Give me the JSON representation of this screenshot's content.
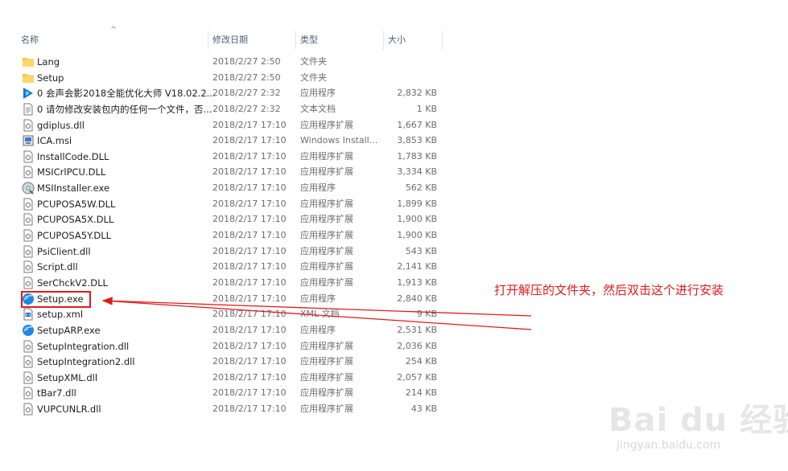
{
  "header": {
    "col_name": "名称",
    "col_date": "修改日期",
    "col_type": "类型",
    "col_size": "大小",
    "sort_arrow": "^"
  },
  "files": [
    {
      "name": "Lang",
      "date": "2018/2/27 2:50",
      "type": "文件夹",
      "size": "",
      "icon": "folder-icon"
    },
    {
      "name": "Setup",
      "date": "2018/2/27 2:50",
      "type": "文件夹",
      "size": "",
      "icon": "folder-icon"
    },
    {
      "name": "0 会声会影2018全能优化大师 V18.02.2...",
      "date": "2018/2/27 2:32",
      "type": "应用程序",
      "size": "2,832 KB",
      "icon": "app-blue-icon"
    },
    {
      "name": "0 请勿修改安装包内的任何一个文件，否...",
      "date": "2018/2/27 2:32",
      "type": "文本文档",
      "size": "1 KB",
      "icon": "text-file-icon"
    },
    {
      "name": "gdiplus.dll",
      "date": "2018/2/17 17:10",
      "type": "应用程序扩展",
      "size": "1,667 KB",
      "icon": "dll-icon"
    },
    {
      "name": "ICA.msi",
      "date": "2018/2/17 17:10",
      "type": "Windows Install...",
      "size": "3,853 KB",
      "icon": "msi-icon"
    },
    {
      "name": "InstallCode.DLL",
      "date": "2018/2/17 17:10",
      "type": "应用程序扩展",
      "size": "1,783 KB",
      "icon": "dll-icon"
    },
    {
      "name": "MSICrlPCU.DLL",
      "date": "2018/2/17 17:10",
      "type": "应用程序扩展",
      "size": "3,334 KB",
      "icon": "dll-icon"
    },
    {
      "name": "MSIInstaller.exe",
      "date": "2018/2/17 17:10",
      "type": "应用程序",
      "size": "562 KB",
      "icon": "cd-installer-icon"
    },
    {
      "name": "PCUPOSA5W.DLL",
      "date": "2018/2/17 17:10",
      "type": "应用程序扩展",
      "size": "1,899 KB",
      "icon": "dll-icon"
    },
    {
      "name": "PCUPOSA5X.DLL",
      "date": "2018/2/17 17:10",
      "type": "应用程序扩展",
      "size": "1,900 KB",
      "icon": "dll-icon"
    },
    {
      "name": "PCUPOSA5Y.DLL",
      "date": "2018/2/17 17:10",
      "type": "应用程序扩展",
      "size": "1,900 KB",
      "icon": "dll-icon"
    },
    {
      "name": "PsiClient.dll",
      "date": "2018/2/17 17:10",
      "type": "应用程序扩展",
      "size": "543 KB",
      "icon": "dll-icon"
    },
    {
      "name": "Script.dll",
      "date": "2018/2/17 17:10",
      "type": "应用程序扩展",
      "size": "2,141 KB",
      "icon": "dll-icon"
    },
    {
      "name": "SerChckV2.DLL",
      "date": "2018/2/17 17:10",
      "type": "应用程序扩展",
      "size": "1,913 KB",
      "icon": "dll-icon"
    },
    {
      "name": "Setup.exe",
      "date": "2018/2/17 17:10",
      "type": "应用程序",
      "size": "2,840 KB",
      "icon": "setup-globe-icon"
    },
    {
      "name": "setup.xml",
      "date": "2018/2/17 17:10",
      "type": "XML 文档",
      "size": "9 KB",
      "icon": "xml-icon"
    },
    {
      "name": "SetupARP.exe",
      "date": "2018/2/17 17:10",
      "type": "应用程序",
      "size": "2,531 KB",
      "icon": "setup-globe-icon"
    },
    {
      "name": "SetupIntegration.dll",
      "date": "2018/2/17 17:10",
      "type": "应用程序扩展",
      "size": "2,036 KB",
      "icon": "dll-icon"
    },
    {
      "name": "SetupIntegration2.dll",
      "date": "2018/2/17 17:10",
      "type": "应用程序扩展",
      "size": "254 KB",
      "icon": "dll-icon"
    },
    {
      "name": "SetupXML.dll",
      "date": "2018/2/17 17:10",
      "type": "应用程序扩展",
      "size": "2,057 KB",
      "icon": "dll-icon"
    },
    {
      "name": "tBar7.dll",
      "date": "2018/2/17 17:10",
      "type": "应用程序扩展",
      "size": "214 KB",
      "icon": "dll-icon"
    },
    {
      "name": "VUPCUNLR.dll",
      "date": "2018/2/17 17:10",
      "type": "应用程序扩展",
      "size": "43 KB",
      "icon": "dll-icon"
    }
  ],
  "annotation": {
    "text": "打开解压的文件夹，然后双击这个进行安装",
    "color": "#e01b1b"
  },
  "watermark": {
    "brand": "Bai du 经验",
    "url": "jingyan.baidu.com"
  },
  "colors": {
    "folder": "#f5c342",
    "header_text": "#4c607a",
    "detail_text": "#6d6d6d",
    "highlight": "#e01b1b"
  }
}
